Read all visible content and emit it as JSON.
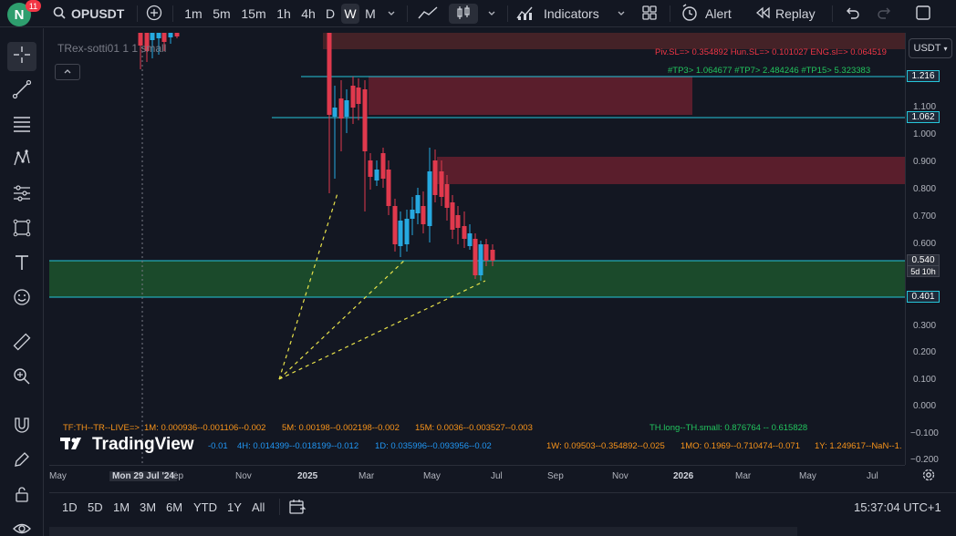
{
  "topbar": {
    "avatar_letter": "N",
    "badge_count": "11",
    "symbol": "OPUSDT",
    "intervals": [
      "1m",
      "5m",
      "15m",
      "1h",
      "4h",
      "D",
      "W",
      "M"
    ],
    "active_interval": "W",
    "indicators_label": "Indicators",
    "alert_label": "Alert",
    "replay_label": "Replay"
  },
  "chart": {
    "indicator_title": "TRex-sotti01 1 1 small",
    "levels_text": "Piv.SL=> 0.354892  Hun.SL=> 0.101027  ENG.sl=> 0.064519",
    "tp_text": "#TP3> 1.064677  #TP7> 2.484246  #TP15> 5.323383",
    "tf_text": "TF:TH--TR--LIVE=>",
    "tf_values": [
      "1M: 0.000936--0.001106--0.002",
      "5M: 0.00198--0.002198--0.002",
      "15M: 0.0036--0.003527--0.003"
    ],
    "th_text": "TH.long--TH.small: 0.876764 -- 0.615828",
    "row2_values": [
      "-0.01",
      "4H: 0.014399--0.018199--0.012",
      "1D: 0.035996--0.093956--0.02"
    ],
    "row2_right": [
      "1W: 0.09503--0.354892--0.025",
      "1MO: 0.1969--0.710474--0.071",
      "1Y: 1.249617--NaN--1."
    ],
    "watermark": "TradingView"
  },
  "price_axis": {
    "currency": "USDT",
    "ticks": [
      "1.100",
      "1.000",
      "0.900",
      "0.800",
      "0.700",
      "0.600",
      "0.500",
      "0.300",
      "0.200",
      "0.100",
      "0.000",
      "−0.100",
      "−0.200"
    ],
    "marker_high": "1.216",
    "marker_tp": "1.062",
    "marker_current": "0.540",
    "marker_countdown": "5d 10h",
    "marker_low": "0.401"
  },
  "time_axis": {
    "labels": [
      "May",
      "Mon 29 Jul '24",
      "ep",
      "Nov",
      "2025",
      "Mar",
      "May",
      "Jul",
      "Sep",
      "Nov",
      "2026",
      "Mar",
      "May",
      "Jul"
    ]
  },
  "bottombar": {
    "ranges": [
      "1D",
      "5D",
      "1M",
      "3M",
      "6M",
      "YTD",
      "1Y",
      "All"
    ],
    "clock": "15:37:04 UTC+1"
  },
  "colors": {
    "bg": "#131722",
    "up": "#26a9e0",
    "down": "#e0394d",
    "zone_green": "#1b4a2b",
    "zone_red": "#5a1e2c",
    "line_cyan": "#26c6da",
    "tp_green": "#22c55e",
    "sl_red": "#f23645"
  }
}
